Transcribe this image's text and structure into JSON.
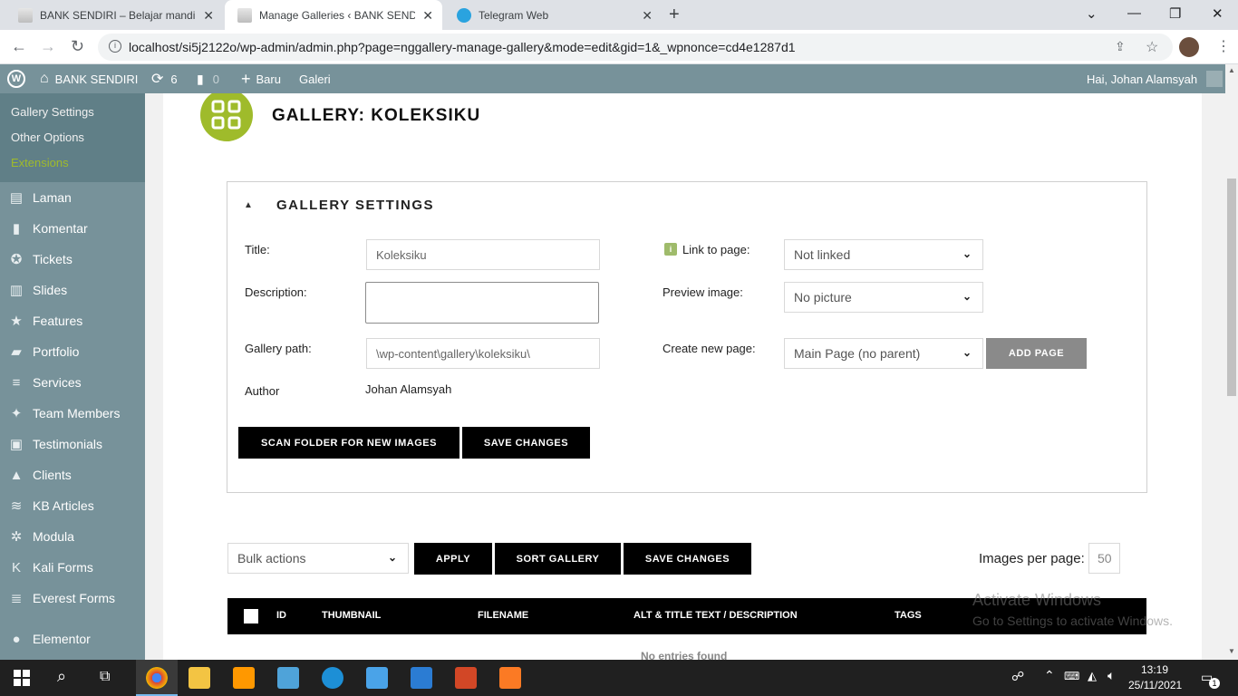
{
  "browser": {
    "tabs": [
      {
        "title": "BANK SENDIRI – Belajar mandiri"
      },
      {
        "title": "Manage Galleries ‹ BANK SENDIRI"
      },
      {
        "title": "Telegram Web"
      }
    ],
    "url": "localhost/si5j2122o/wp-admin/admin.php?page=nggallery-manage-gallery&mode=edit&gid=1&_wpnonce=cd4e1287d1"
  },
  "adminbar": {
    "site_name": "BANK SENDIRI",
    "updates_count": "6",
    "comments_count": "0",
    "new_label": "Baru",
    "gallery_label": "Galeri",
    "greeting": "Hai, Johan Alamsyah"
  },
  "sidebar": {
    "submenu": [
      "Gallery Settings",
      "Other Options",
      "Extensions"
    ],
    "items": [
      "Laman",
      "Komentar",
      "Tickets",
      "Slides",
      "Features",
      "Portfolio",
      "Services",
      "Team Members",
      "Testimonials",
      "Clients",
      "KB Articles",
      "Modula",
      "Kali Forms",
      "Everest Forms",
      "Elementor"
    ],
    "icons": [
      "pages-icon",
      "comment-icon",
      "tickets-icon",
      "slides-icon",
      "star-icon",
      "portfolio-icon",
      "services-icon",
      "team-icon",
      "testimonials-icon",
      "clients-icon",
      "kb-icon",
      "modula-icon",
      "kali-icon",
      "everest-icon",
      "elementor-icon"
    ]
  },
  "page": {
    "title": "GALLERY: KOLEKSIKU",
    "settings_heading": "GALLERY SETTINGS",
    "fields": {
      "title_label": "Title:",
      "title_value": "Koleksiku",
      "description_label": "Description:",
      "description_value": "",
      "path_label": "Gallery path:",
      "path_value": "\\wp-content\\gallery\\koleksiku\\",
      "author_label": "Author",
      "author_value": "Johan Alamsyah",
      "link_label": "Link to page:",
      "link_value": "Not linked",
      "preview_label": "Preview image:",
      "preview_value": "No picture",
      "newpage_label": "Create new page:",
      "newpage_value": "Main Page (no parent)",
      "add_page": "ADD PAGE"
    },
    "scan_button": "SCAN FOLDER FOR NEW IMAGES",
    "save_button": "SAVE CHANGES",
    "bulk_actions": "Bulk actions",
    "apply": "APPLY",
    "sort_gallery": "SORT GALLERY",
    "save_changes": "SAVE CHANGES",
    "images_per_page_label": "Images per page:",
    "images_per_page_value": "50",
    "table_headers": [
      "ID",
      "THUMBNAIL",
      "FILENAME",
      "ALT & TITLE TEXT / DESCRIPTION",
      "TAGS"
    ],
    "empty_text": "No entries found"
  },
  "watermark": {
    "line1": "Activate Windows",
    "line2": "Go to Settings to activate Windows."
  },
  "taskbar": {
    "time": "13:19",
    "date": "25/11/2021",
    "notif_count": "1"
  },
  "colors": {
    "admin_bar": "#77929a",
    "accent_green": "#9fbb2b"
  }
}
